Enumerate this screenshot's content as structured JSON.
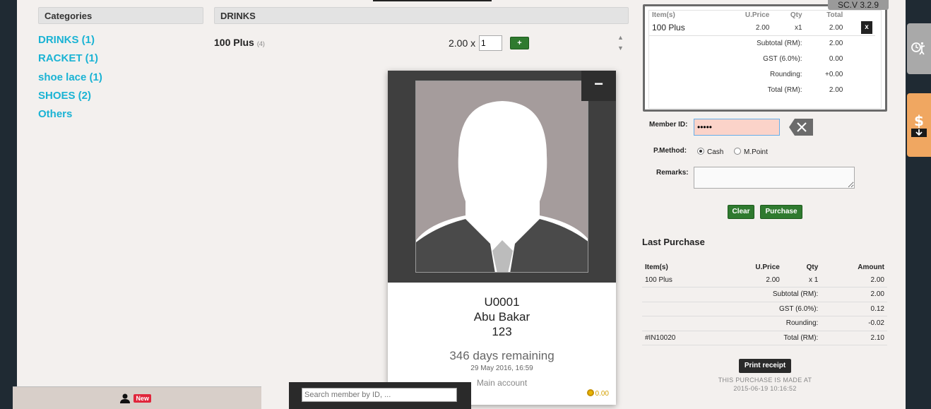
{
  "version": "SC.V 3.2.9",
  "categories": {
    "header": "Categories",
    "items": [
      {
        "label": "DRINKS (1)"
      },
      {
        "label": "RACKET (1)"
      },
      {
        "label": "shoe lace (1)"
      },
      {
        "label": "SHOES (2)"
      },
      {
        "label": "Others"
      }
    ]
  },
  "products": {
    "header": "DRINKS",
    "item": {
      "name": "100 Plus",
      "count": "(4)",
      "price": "2.00 x",
      "qty": "1",
      "add_label": "+"
    }
  },
  "member": {
    "minimize_label": "−",
    "id": "U0001",
    "name": "Abu Bakar",
    "code": "123",
    "days_remaining": "346 days remaining",
    "date": "29 May 2016, 16:59",
    "account": "Main account",
    "points": "0.00"
  },
  "cart": {
    "headers": {
      "item": "Item(s)",
      "uprice": "U.Price",
      "qty": "Qty",
      "total": "Total"
    },
    "item": {
      "name": "100 Plus",
      "uprice": "2.00",
      "qty": "x1",
      "total": "2.00",
      "remove_label": "x"
    },
    "subtotal_label": "Subtotal (RM):",
    "subtotal": "2.00",
    "gst_label": "GST (6.0%):",
    "gst": "0.00",
    "rounding_label": "Rounding:",
    "rounding": "+0.00",
    "total_label": "Total (RM):",
    "total": "2.00"
  },
  "form": {
    "member_id_label": "Member ID:",
    "member_id_value": "•••••",
    "pmethod_label": "P.Method:",
    "cash_label": "Cash",
    "mpoint_label": "M.Point",
    "remarks_label": "Remarks:",
    "clear_label": "Clear",
    "purchase_label": "Purchase"
  },
  "last_purchase": {
    "title": "Last Purchase",
    "headers": {
      "item": "Item(s)",
      "uprice": "U.Price",
      "qty": "Qty",
      "amount": "Amount"
    },
    "item": {
      "name": "100 Plus",
      "uprice": "2.00",
      "qty": "x 1",
      "amount": "2.00"
    },
    "subtotal_label": "Subtotal (RM):",
    "subtotal": "2.00",
    "gst_label": "GST (6.0%):",
    "gst": "0.12",
    "rounding_label": "Rounding:",
    "rounding": "-0.02",
    "invoice": "#IN10020",
    "total_label": "Total (RM):",
    "total": "2.10",
    "print_label": "Print receipt",
    "made_at_label": "THIS PURCHASE IS MADE AT",
    "made_at": "2015-06-19 10:16:52"
  },
  "bottom": {
    "new_label": "New",
    "search_placeholder": "Search member by ID, ..."
  },
  "colors": {
    "accent_cyan": "#1ab3d4",
    "button_green": "#2f7a2f",
    "member_input_bg": "#fbd3c9",
    "side_tab_orange": "#f0a761",
    "new_badge_red": "#e0263c"
  }
}
